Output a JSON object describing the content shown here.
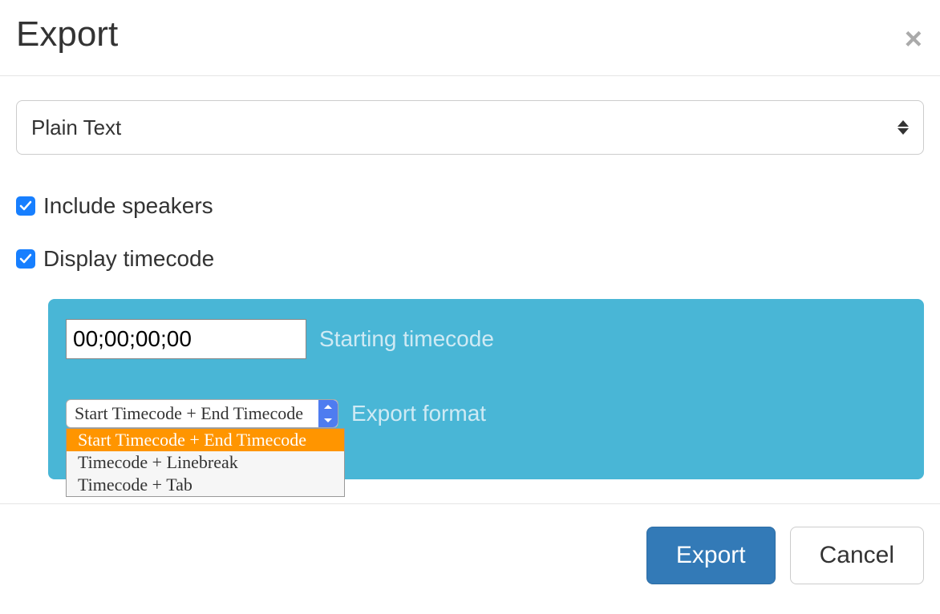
{
  "modal": {
    "title": "Export",
    "close_icon": "×"
  },
  "format_select": {
    "value": "Plain Text"
  },
  "options": {
    "include_speakers": {
      "label": "Include speakers",
      "checked": true
    },
    "display_timecode": {
      "label": "Display timecode",
      "checked": true
    }
  },
  "timecode_panel": {
    "starting_timecode_value": "00;00;00;00",
    "starting_timecode_label": "Starting timecode",
    "export_format_label": "Export format",
    "export_format_selected": "Start Timecode + End Timecode",
    "export_format_options": [
      "Start Timecode + End Timecode",
      "Timecode + Linebreak",
      "Timecode + Tab"
    ]
  },
  "footer": {
    "export_label": "Export",
    "cancel_label": "Cancel"
  },
  "colors": {
    "accent_blue": "#177fff",
    "panel_blue": "#49b6d6",
    "dropdown_highlight": "#ff9500",
    "primary_btn": "#337ab7"
  }
}
